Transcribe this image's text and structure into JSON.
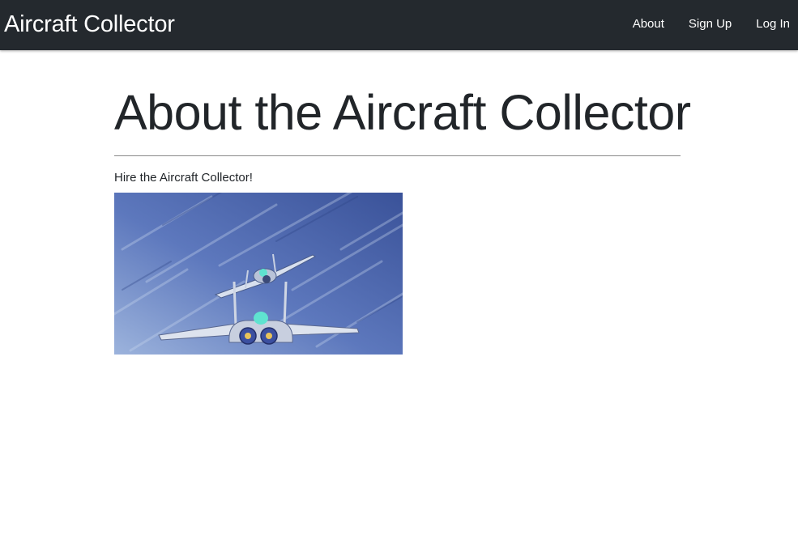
{
  "navbar": {
    "brand": "Aircraft Collector",
    "links": [
      {
        "label": "About"
      },
      {
        "label": "Sign Up"
      },
      {
        "label": "Log In"
      }
    ]
  },
  "main": {
    "title": "About the Aircraft Collector",
    "intro": "Hire the Aircraft Collector!",
    "image": {
      "icon": "fighter-jets-illustration"
    }
  },
  "colors": {
    "navbar_bg": "#24292e",
    "nav_text": "#ffffff",
    "body_text": "#212529",
    "sky_light": "#8fa9d6",
    "sky_dark": "#3f5aa6"
  }
}
